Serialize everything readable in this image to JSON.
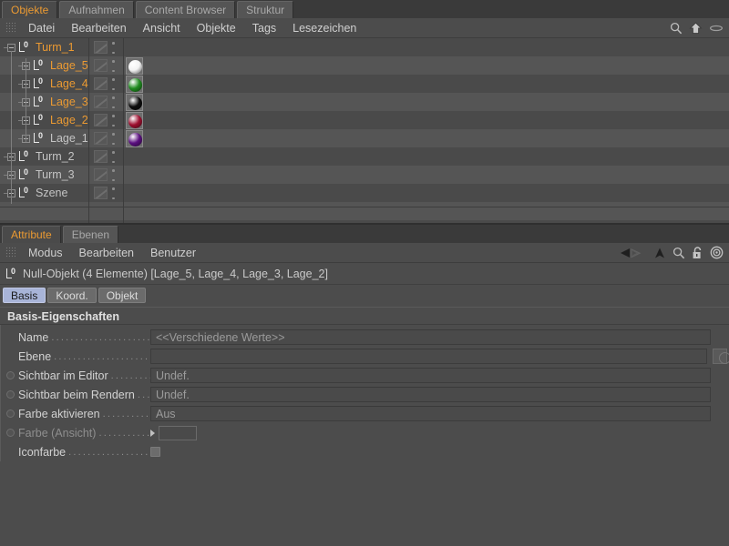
{
  "top_tabs": [
    {
      "label": "Objekte",
      "active": true
    },
    {
      "label": "Aufnahmen",
      "active": false
    },
    {
      "label": "Content Browser",
      "active": false
    },
    {
      "label": "Struktur",
      "active": false
    }
  ],
  "object_menu": {
    "items": [
      "Datei",
      "Bearbeiten",
      "Ansicht",
      "Objekte",
      "Tags",
      "Lesezeichen"
    ],
    "icons": [
      "search-icon",
      "home-icon",
      "eye-icon"
    ]
  },
  "object_tree": {
    "rows": [
      {
        "name": "Turm_1",
        "depth": 0,
        "expanded": true,
        "color": "orange",
        "has_tag": true,
        "material": null
      },
      {
        "name": "Lage_5",
        "depth": 1,
        "expanded": false,
        "color": "orange",
        "has_tag": true,
        "material": "#f2f2f2"
      },
      {
        "name": "Lage_4",
        "depth": 1,
        "expanded": false,
        "color": "orange",
        "has_tag": true,
        "material": "#1f8c1f"
      },
      {
        "name": "Lage_3",
        "depth": 1,
        "expanded": false,
        "color": "orange",
        "has_tag": true,
        "material": "#0d0d0d"
      },
      {
        "name": "Lage_2",
        "depth": 1,
        "expanded": false,
        "color": "orange",
        "has_tag": true,
        "material": "#9e1030"
      },
      {
        "name": "Lage_1",
        "depth": 1,
        "expanded": false,
        "color": "grey",
        "has_tag": true,
        "material": "#5b1080"
      },
      {
        "name": "Turm_2",
        "depth": 0,
        "expanded": false,
        "color": "grey",
        "has_tag": true,
        "material": null
      },
      {
        "name": "Turm_3",
        "depth": 0,
        "expanded": false,
        "color": "grey",
        "has_tag": true,
        "material": null
      },
      {
        "name": "Szene",
        "depth": 0,
        "expanded": false,
        "color": "grey",
        "has_tag": true,
        "material": null
      }
    ]
  },
  "lower_tabs": [
    {
      "label": "Attribute",
      "active": true
    },
    {
      "label": "Ebenen",
      "active": false
    }
  ],
  "attribute_menu": {
    "items": [
      "Modus",
      "Bearbeiten",
      "Benutzer"
    ],
    "icons": [
      "back-forward-icon",
      "up-arrow-icon",
      "search-icon",
      "lock-icon",
      "target-icon"
    ]
  },
  "object_header": {
    "icon": "null-object-icon",
    "text": "Null-Objekt (4 Elemente) [Lage_5, Lage_4, Lage_3, Lage_2]"
  },
  "sub_tabs": [
    {
      "label": "Basis",
      "active": true
    },
    {
      "label": "Koord.",
      "active": false
    },
    {
      "label": "Objekt",
      "active": false
    }
  ],
  "properties": {
    "section_title": "Basis-Eigenschaften",
    "rows": [
      {
        "label": "Name",
        "keydot": false,
        "dim": false,
        "arrow": false,
        "control": "text",
        "value": "<<Verschiedene Werte>>"
      },
      {
        "label": "Ebene",
        "keydot": false,
        "dim": false,
        "arrow": false,
        "control": "layer",
        "value": ""
      },
      {
        "label": "Sichtbar im Editor",
        "keydot": true,
        "dim": false,
        "arrow": false,
        "control": "text",
        "value": "Undef."
      },
      {
        "label": "Sichtbar beim Rendern",
        "keydot": true,
        "dim": false,
        "arrow": false,
        "control": "text",
        "value": "Undef."
      },
      {
        "label": "Farbe aktivieren",
        "keydot": true,
        "dim": false,
        "arrow": false,
        "control": "text",
        "value": "Aus"
      },
      {
        "label": "Farbe (Ansicht)",
        "keydot": true,
        "dim": true,
        "arrow": true,
        "control": "swatch",
        "value": ""
      },
      {
        "label": "Iconfarbe",
        "keydot": false,
        "dim": false,
        "arrow": false,
        "control": "check",
        "value": ""
      }
    ]
  },
  "colors": {
    "accent": "#eb9a32",
    "panel": "#4c4c4c",
    "row_a": "#4a4a4a",
    "row_b": "#555555",
    "tab_active": "#a8b4d8"
  }
}
